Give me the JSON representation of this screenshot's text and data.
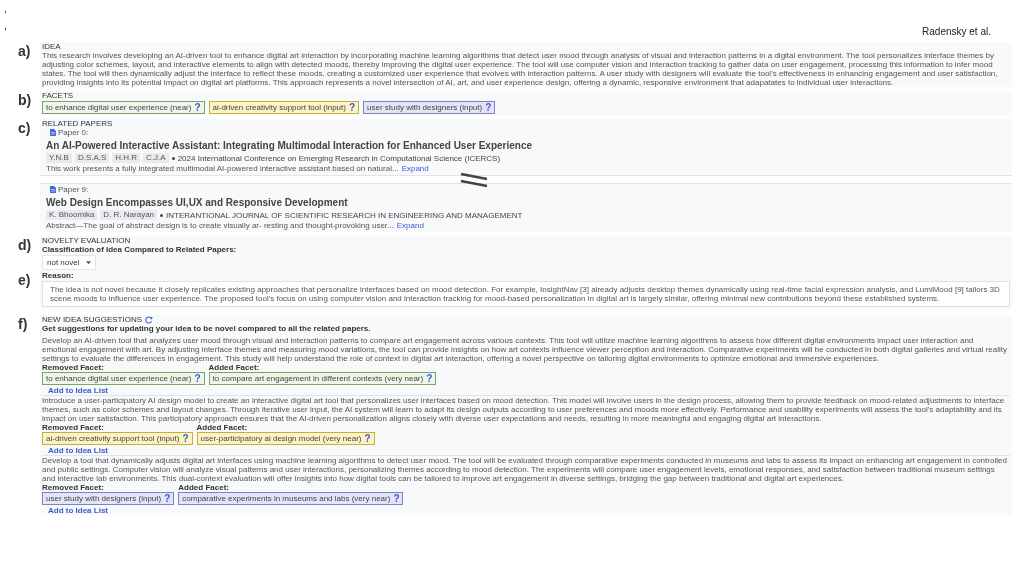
{
  "margin_marks": [
    ",",
    ","
  ],
  "running_header": "Radensky et al.",
  "idea": {
    "label": "a)",
    "heading": "IDEA",
    "text": "This research involves developing an AI-driven tool to enhance digital art interaction by incorporating machine learning algorithms that detect user mood through analysis of visual and interaction patterns in a digital environment. The tool personalizes interface themes by adjusting color schemes, layout, and interactive elements to align with detected moods, thereby improving the digital user experience. The tool will use computer vision and interaction tracking to gather data on user engagement, processing this information to infer mood states. The tool will then dynamically adjust the interface to reflect these moods, creating a customized user experience that evolves with interaction patterns. A user study with designers will evaluate the tool's effectiveness in enhancing engagement and user satisfaction, providing insights into its potential impact on digital art platforms. This approach represents a novel intersection of AI, art, and user experience design, offering a dynamic, responsive environment that adapatates to individual user interactions."
  },
  "facets": {
    "label": "b)",
    "heading": "FACETS",
    "items": [
      {
        "text": "to enhance digital user experience (near)",
        "help": "?",
        "color": "#eef6ea"
      },
      {
        "text": "ai-driven creativity support tool (input)",
        "help": "?",
        "color": "#fbf3c4"
      },
      {
        "text": "user study with designers (input)",
        "help": "?",
        "color": "#e3e4f7"
      }
    ]
  },
  "related_papers": {
    "label": "c)",
    "heading": "RELATED PAPERS",
    "papers": [
      {
        "number": "Paper 0:",
        "title": "An AI-Powered Interactive Assistant: Integrating Multimodal Interaction for Enhanced User Experience",
        "authors": [
          "Y.N.B",
          "D.S.A.S",
          "H.H.R",
          "C.J.A"
        ],
        "venue": "2024 International Conference on Emerging Research in Computational Science (ICERCS)",
        "abstract": "This work presents a fully integrated multimodal AI-powered interactive assistant based on natural...",
        "expand": "Expand"
      },
      {
        "number": "Paper 9:",
        "title": "Web Design Encompasses UI,UX and Responsive Development",
        "authors": [
          "K. Bhoomika",
          "D. R. Narayan"
        ],
        "venue": "INTERANTIONAL JOURNAL OF SCIENTIFIC RESEARCH IN ENGINEERING AND MANAGEMENT",
        "abstract": "Abstract—The goal of abstract design is to create visually ar- resting and thought-provoking user...",
        "expand": "Expand"
      }
    ]
  },
  "novelty": {
    "label": "d)",
    "heading": "NOVELTY EVALUATION",
    "question": "Classification of Idea Compared to Related Papers:",
    "classification": "not novel",
    "reason_marker": "e)",
    "reason_label": "Reason:",
    "reason": "The idea is not novel because it closely replicates existing approaches that personalize interfaces based on mood detection. For example, InsightNav [3] already adjusts desktop themes dynamically using real-time facial expression analysis, and LumiMood [9] tailors 3D scene moods to influence user experience. The proposed tool's focus on using computer vision and interaction tracking for mood-based personalization in digital art is largely similar, offering minimal new contributions beyond these established systems."
  },
  "suggestions": {
    "label": "f)",
    "heading": "NEW IDEA SUGGESTIONS",
    "subheading": "Get suggestions for updating your idea to be novel compared to all the related papers.",
    "items": [
      {
        "text": "Develop an AI-driven tool that analyzes user mood through visual and interaction patterns to compare art engagement across various contexts. This tool will utilize machine learning algorithms to assess how different digital environments impact user interaction and emotional engagement with art. By adjusting interface themes and measuring mood variations, the tool can provide insights on how art contexts influence viewer perception and interaction. Comparative experiments will be conducted in both digital galleries and virtual reality settings to evaluate the differences in engagement. This study will help understand the role of context in digital art interaction, offering a novel perspective on tailoring digital environments to optimize emotional and immersive experiences.",
        "removed_label": "Removed Facet:",
        "removed": {
          "text": "to enhance digital user experience (near)",
          "help": "?",
          "color": "#eef6ea"
        },
        "added_label": "Added Facet:",
        "added": {
          "text": "to compare art engagement in different contexts (very near)",
          "help": "?",
          "color": "#eef6ea"
        },
        "action": "Add to Idea List"
      },
      {
        "text": "Introduce a user-participatory AI design model to create an interactive digital art tool that personalizes user interfaces based on mood detection. This model will involve users in the design process, allowing them to provide feedback on mood-related adjustments to interface themes, such as color schemes and layout changes. Through iterative user input, the AI system will learn to adapt its design outputs according to user preferences and moods more effectively. Performance and usability experiments will assess the tool's adaptability and its impact on user satisfaction. This participatory approach ensures that the AI-driven personalization aligns closely with diverse user expectations and needs, resulting in more meaningful and engaging digital art interactions.",
        "removed_label": "Removed Facet:",
        "removed": {
          "text": "ai-driven creativity support tool (input)",
          "help": "?",
          "color": "#fbf3c4"
        },
        "added_label": "Added Facet:",
        "added": {
          "text": "user-participatory ai design model (very near)",
          "help": "?",
          "color": "#fbf3c4"
        },
        "action": "Add to Idea List"
      },
      {
        "text": "Develop a tool that dynamically adjusts digital art interfaces using machine learning algorithms to detect user mood. The tool will be evaluated through comparative experiments conducted in museums and labs to assess its impact on enhancing art engagement in controlled and public settings. Computer vision will analyze visual patterns and user interactions, personalizing themes according to mood detection. The experiments will compare user engagement levels, emotional responses, and satisfaction between traditional museum settings and interactive lab environments. This dual-context evaluation will offer insights into how digital tools can be tailored to improve art engagement in diverse settings, bridging the gap between traditional and digital art experiences.",
        "removed_label": "Removed Facet:",
        "removed": {
          "text": "user study with designers (input)",
          "help": "?",
          "color": "#e3e4f7"
        },
        "added_label": "Added Facet:",
        "added": {
          "text": "comparative experiments in museums and labs (very near)",
          "help": "?",
          "color": "#e3e4f7"
        },
        "action": "Add to Idea List"
      }
    ]
  }
}
